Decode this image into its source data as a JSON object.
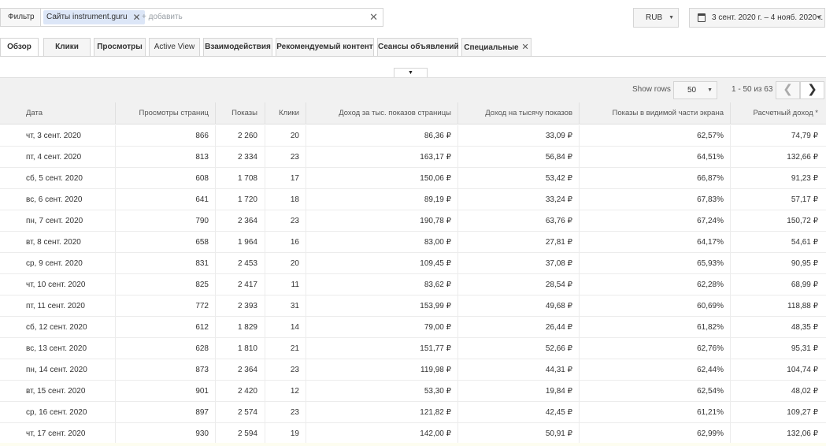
{
  "filter": {
    "label": "Фильтр",
    "chip": "Сайты instrument.guru",
    "chip_close": "✕",
    "add": "+ добавить",
    "clear": "✕"
  },
  "currency": {
    "value": "RUB",
    "arrow": "▼"
  },
  "daterange": {
    "value": "3 сент. 2020 г. – 4 нояб. 2020 г.",
    "arrow": "▼"
  },
  "tabs": [
    {
      "label": "Обзор"
    },
    {
      "label": "Клики"
    },
    {
      "label": "Просмотры"
    },
    {
      "label": "Active View"
    },
    {
      "label": "Взаимодействия"
    },
    {
      "label": "Рекомендуемый контент"
    },
    {
      "label": "Сеансы объявлений"
    },
    {
      "label": "Специальные",
      "close": "✕"
    }
  ],
  "chart_toggle": "▼",
  "pagination": {
    "show_rows_label": "Show rows",
    "rows_value": "50",
    "rows_arrow": "▼",
    "range": "1 - 50 из 63",
    "prev": "❮",
    "next": "❯"
  },
  "table": {
    "headers": [
      "Дата",
      "Просмотры страниц",
      "Показы",
      "Клики",
      "Доход за тыс. показов страницы",
      "Доход на тысячу показов",
      "Показы в видимой части экрана",
      "Расчетный доход *"
    ],
    "rows": [
      [
        "чт, 3 сент. 2020",
        "866",
        "2 260",
        "20",
        "86,36 ₽",
        "33,09 ₽",
        "62,57%",
        "74,79 ₽"
      ],
      [
        "пт, 4 сент. 2020",
        "813",
        "2 334",
        "23",
        "163,17 ₽",
        "56,84 ₽",
        "64,51%",
        "132,66 ₽"
      ],
      [
        "сб, 5 сент. 2020",
        "608",
        "1 708",
        "17",
        "150,06 ₽",
        "53,42 ₽",
        "66,87%",
        "91,23 ₽"
      ],
      [
        "вс, 6 сент. 2020",
        "641",
        "1 720",
        "18",
        "89,19 ₽",
        "33,24 ₽",
        "67,83%",
        "57,17 ₽"
      ],
      [
        "пн, 7 сент. 2020",
        "790",
        "2 364",
        "23",
        "190,78 ₽",
        "63,76 ₽",
        "67,24%",
        "150,72 ₽"
      ],
      [
        "вт, 8 сент. 2020",
        "658",
        "1 964",
        "16",
        "83,00 ₽",
        "27,81 ₽",
        "64,17%",
        "54,61 ₽"
      ],
      [
        "ср, 9 сент. 2020",
        "831",
        "2 453",
        "20",
        "109,45 ₽",
        "37,08 ₽",
        "65,93%",
        "90,95 ₽"
      ],
      [
        "чт, 10 сент. 2020",
        "825",
        "2 417",
        "11",
        "83,62 ₽",
        "28,54 ₽",
        "62,28%",
        "68,99 ₽"
      ],
      [
        "пт, 11 сент. 2020",
        "772",
        "2 393",
        "31",
        "153,99 ₽",
        "49,68 ₽",
        "60,69%",
        "118,88 ₽"
      ],
      [
        "сб, 12 сент. 2020",
        "612",
        "1 829",
        "14",
        "79,00 ₽",
        "26,44 ₽",
        "61,82%",
        "48,35 ₽"
      ],
      [
        "вс, 13 сент. 2020",
        "628",
        "1 810",
        "21",
        "151,77 ₽",
        "52,66 ₽",
        "62,76%",
        "95,31 ₽"
      ],
      [
        "пн, 14 сент. 2020",
        "873",
        "2 364",
        "23",
        "119,98 ₽",
        "44,31 ₽",
        "62,44%",
        "104,74 ₽"
      ],
      [
        "вт, 15 сент. 2020",
        "901",
        "2 420",
        "12",
        "53,30 ₽",
        "19,84 ₽",
        "62,54%",
        "48,02 ₽"
      ],
      [
        "ср, 16 сент. 2020",
        "897",
        "2 574",
        "23",
        "121,82 ₽",
        "42,45 ₽",
        "61,21%",
        "109,27 ₽"
      ],
      [
        "чт, 17 сент. 2020",
        "930",
        "2 594",
        "19",
        "142,00 ₽",
        "50,91 ₽",
        "62,99%",
        "132,06 ₽"
      ]
    ]
  },
  "colors": {
    "chip_bg": "#dce6f7",
    "header_bg": "#f1f1f1",
    "border": "#d5d5d5"
  },
  "icons": {
    "calendar": "calendar-icon",
    "close": "close-icon",
    "dropdown": "chevron-down-icon"
  }
}
